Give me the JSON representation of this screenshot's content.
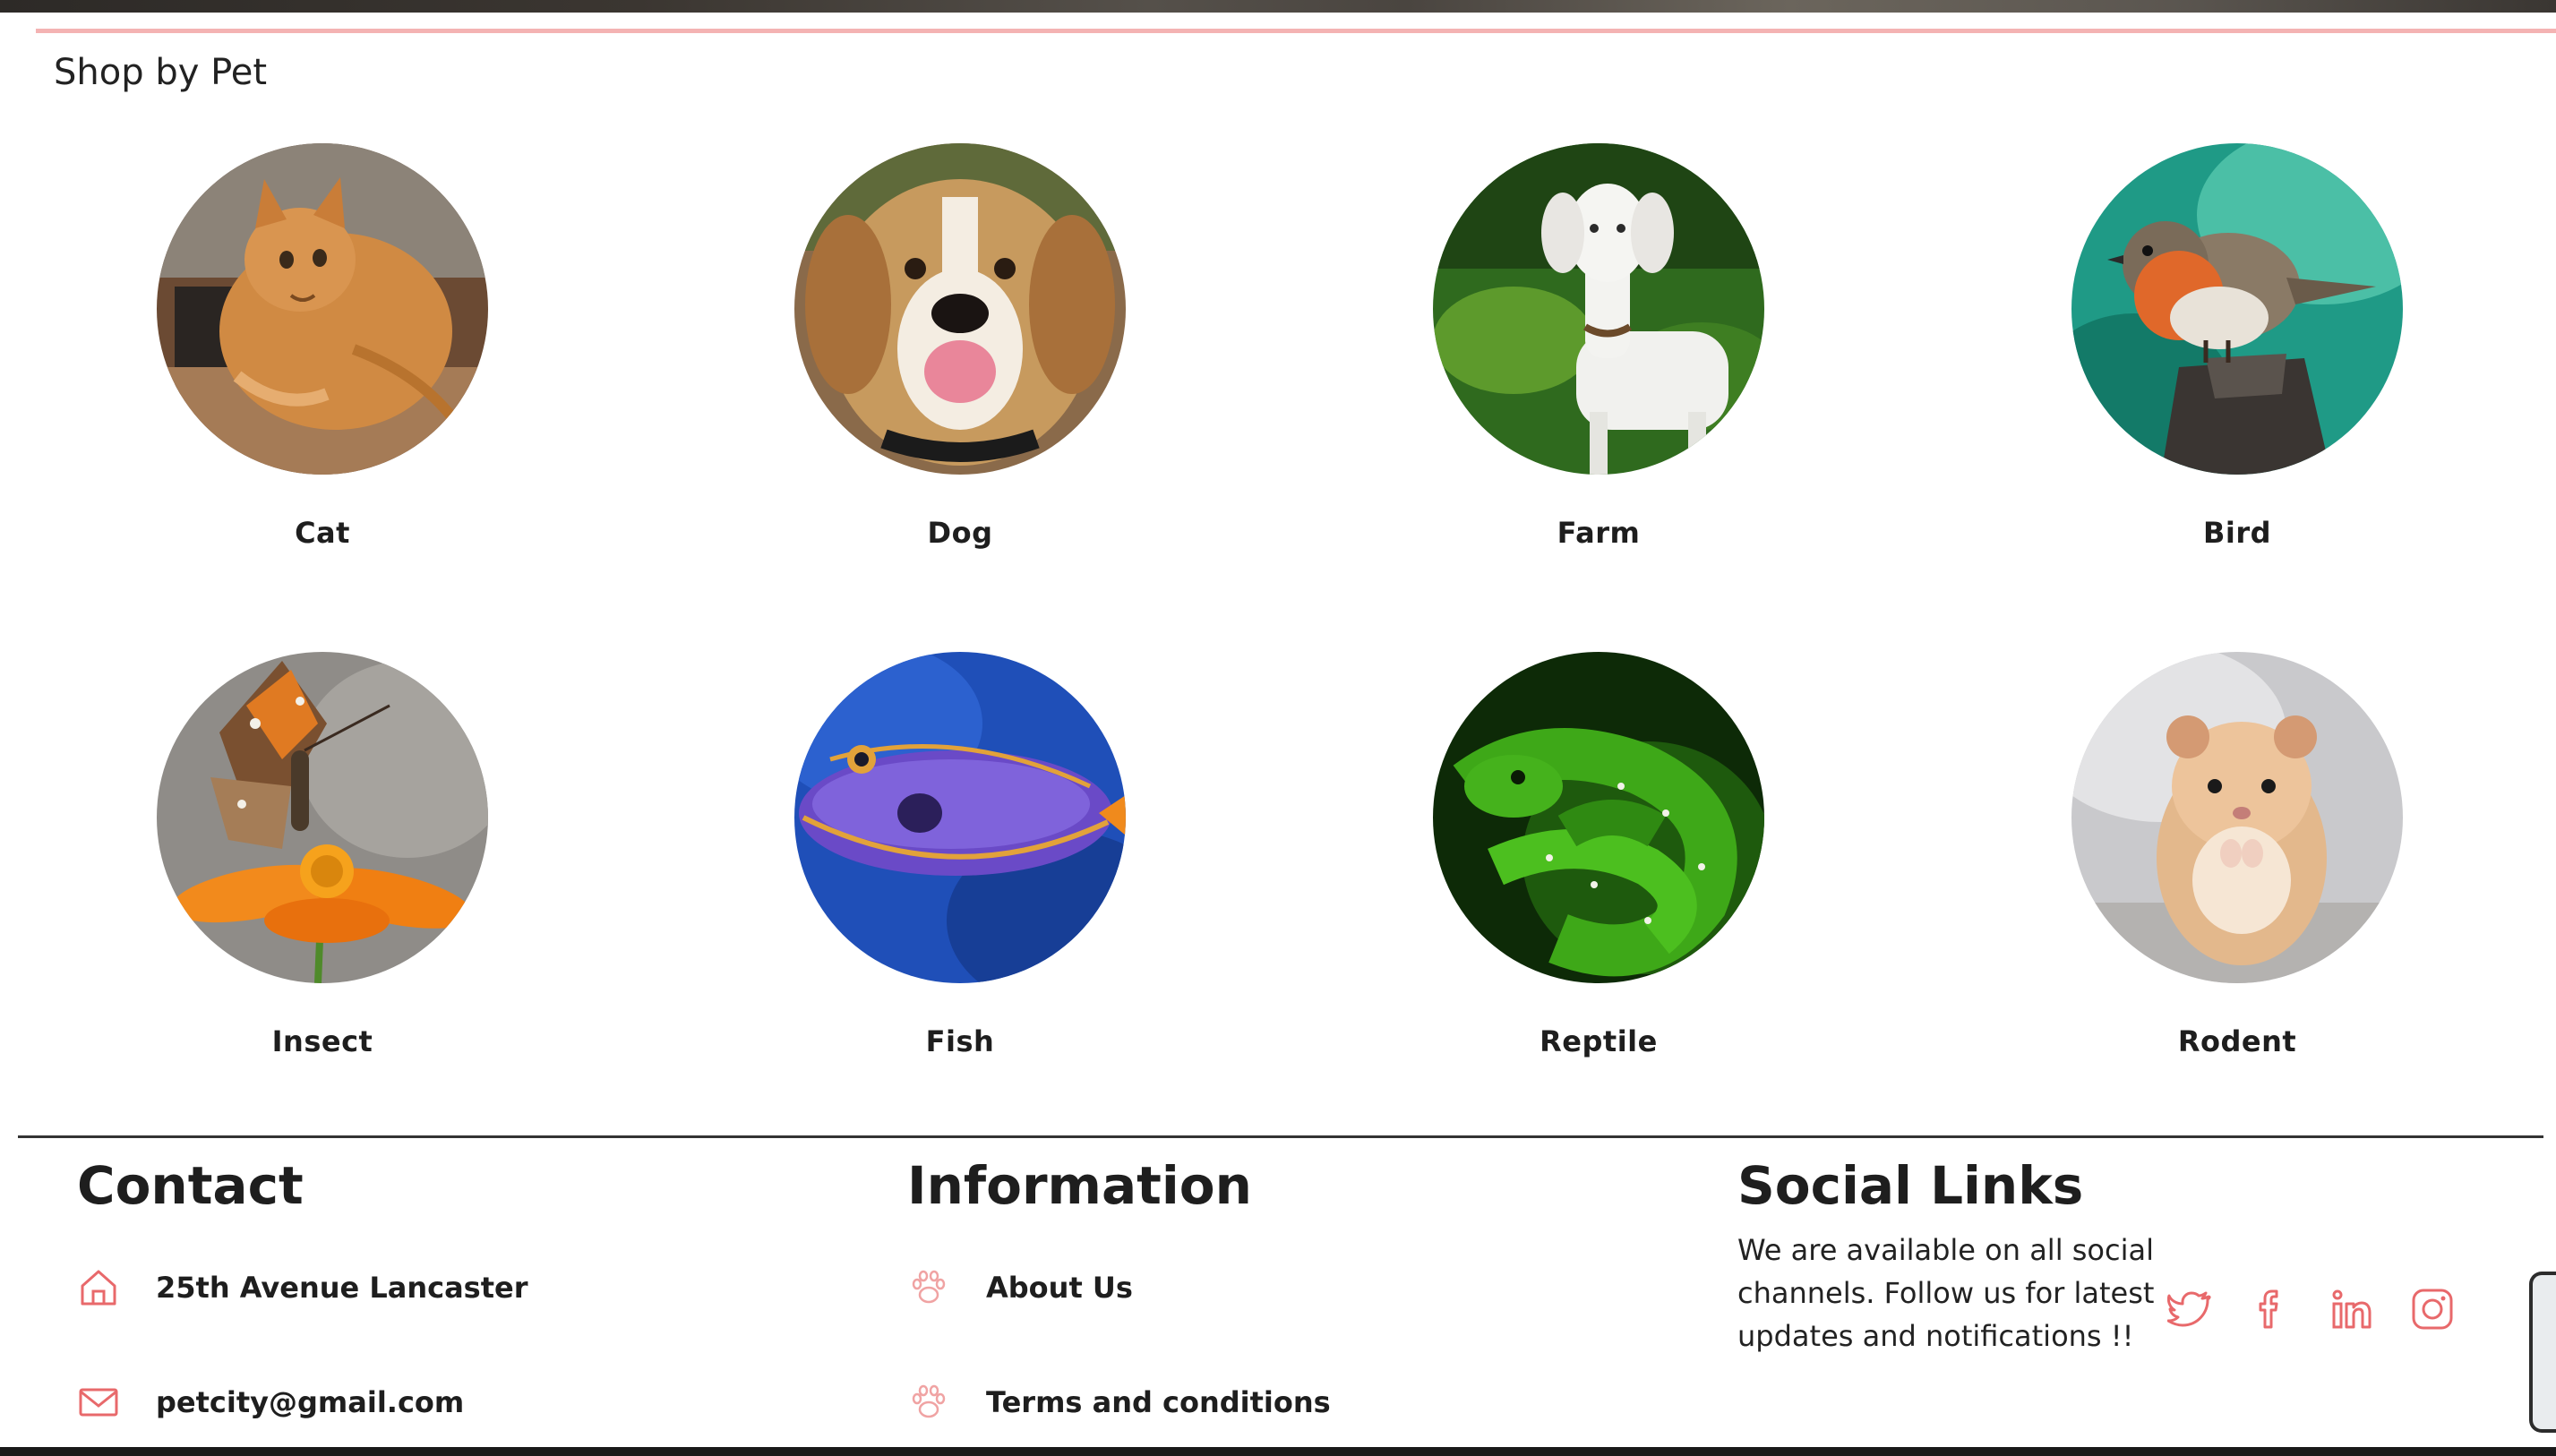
{
  "section": {
    "title": "Shop by Pet"
  },
  "pets": [
    {
      "label": "Cat"
    },
    {
      "label": "Dog"
    },
    {
      "label": "Farm"
    },
    {
      "label": "Bird"
    },
    {
      "label": "Insect"
    },
    {
      "label": "Fish"
    },
    {
      "label": "Reptile"
    },
    {
      "label": "Rodent"
    }
  ],
  "footer": {
    "contact": {
      "heading": "Contact",
      "address": "25th Avenue Lancaster",
      "email": "petcity@gmail.com"
    },
    "information": {
      "heading": "Information",
      "about": "About Us",
      "terms": "Terms and conditions"
    },
    "social": {
      "heading": "Social Links",
      "text": "We are available on all social channels. Follow us for latest updates and notifications !!",
      "icons": [
        "twitter-icon",
        "facebook-icon",
        "linkedin-icon",
        "instagram-icon"
      ]
    }
  },
  "colors": {
    "accent": "#e8696b",
    "rule_pink": "#f4b3b3"
  }
}
